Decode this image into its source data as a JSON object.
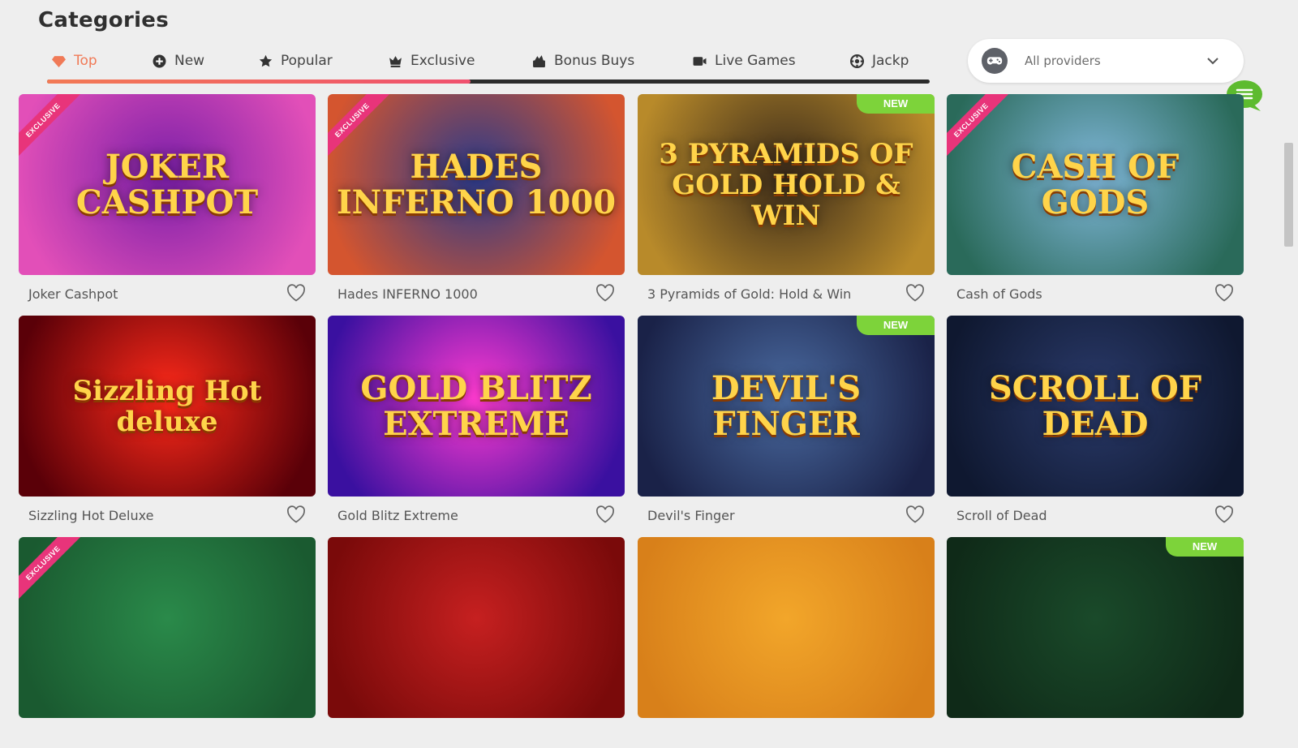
{
  "page_title": "Categories",
  "tabs": [
    {
      "label": "Top",
      "icon": "diamond-icon",
      "active": true
    },
    {
      "label": "New",
      "icon": "plus-circle-icon"
    },
    {
      "label": "Popular",
      "icon": "star-icon"
    },
    {
      "label": "Exclusive",
      "icon": "crown-icon"
    },
    {
      "label": "Bonus Buys",
      "icon": "bonus-buy-icon"
    },
    {
      "label": "Live Games",
      "icon": "video-camera-icon"
    },
    {
      "label": "Jackp",
      "icon": "jackpot-icon"
    }
  ],
  "tab_scroll_progress": 0.48,
  "provider_filter": {
    "selected": "All providers",
    "icon": "gamepad-icon"
  },
  "badges": {
    "exclusive": "EXCLUSIVE",
    "new": "NEW"
  },
  "games": [
    {
      "name": "Joker Cashpot",
      "logo": "JOKER CASHPOT",
      "exclusive": true,
      "new": false,
      "bg": [
        "#7a1fa8",
        "#e24fb8"
      ]
    },
    {
      "name": "Hades INFERNO 1000",
      "logo": "HADES INFERNO 1000",
      "exclusive": true,
      "new": false,
      "bg": [
        "#2a3a8a",
        "#d4552f"
      ]
    },
    {
      "name": "3 Pyramids of Gold: Hold & Win",
      "logo": "3 PYRAMIDS OF GOLD HOLD & WIN",
      "exclusive": false,
      "new": true,
      "bg": [
        "#3a2a1a",
        "#b88a2a"
      ]
    },
    {
      "name": "Cash of Gods",
      "logo": "CASH OF GODS",
      "exclusive": true,
      "new": false,
      "bg": [
        "#7fb6d8",
        "#2a6a5a"
      ]
    },
    {
      "name": "Sizzling Hot Deluxe",
      "logo": "Sizzling Hot deluxe",
      "exclusive": false,
      "new": false,
      "bg": [
        "#ff2a1a",
        "#5a0008"
      ]
    },
    {
      "name": "Gold Blitz Extreme",
      "logo": "GOLD BLITZ EXTREME",
      "exclusive": false,
      "new": false,
      "bg": [
        "#ff3bd0",
        "#3a10a0"
      ]
    },
    {
      "name": "Devil's Finger",
      "logo": "DEVIL'S FINGER",
      "exclusive": false,
      "new": true,
      "bg": [
        "#4a6aa0",
        "#1a2248"
      ]
    },
    {
      "name": "Scroll of Dead",
      "logo": "SCROLL OF DEAD",
      "exclusive": false,
      "new": false,
      "bg": [
        "#2a3a6a",
        "#0f1830"
      ]
    },
    {
      "name": "",
      "logo": "",
      "exclusive": true,
      "new": false,
      "bg": [
        "#2a8a4a",
        "#1a5a30"
      ]
    },
    {
      "name": "",
      "logo": "",
      "exclusive": false,
      "new": false,
      "bg": [
        "#c62020",
        "#7a0a0a"
      ]
    },
    {
      "name": "",
      "logo": "",
      "exclusive": false,
      "new": false,
      "bg": [
        "#f2a62a",
        "#d8801a"
      ]
    },
    {
      "name": "",
      "logo": "",
      "exclusive": false,
      "new": true,
      "bg": [
        "#1a4a2a",
        "#0f2a18"
      ]
    }
  ],
  "colors": {
    "accent": "#f07a57",
    "new_badge": "#7dd33a",
    "exclusive_ribbon": "#e8347a",
    "chat_fab": "#5dbb2f"
  }
}
